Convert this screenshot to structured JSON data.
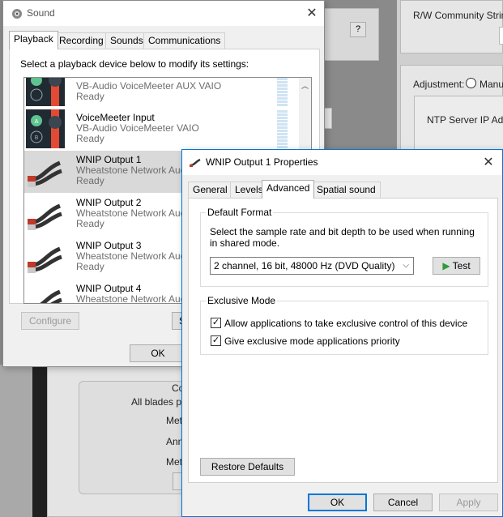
{
  "background": {
    "rw_community_label": "R/W Community String:",
    "adjustment_label": "Adjustment:",
    "manual_partial": "Manua",
    "ntp_label": "NTP Server IP Addr",
    "help_button": "?",
    "panel_heading_partial": "Co",
    "blades_text_partial": "All blades pre",
    "met1": "Met",
    "ann": "Ann",
    "met2": "Met"
  },
  "sound_window": {
    "title": "Sound",
    "tabs": [
      "Playback",
      "Recording",
      "Sounds",
      "Communications"
    ],
    "instruction": "Select a playback device below to modify its settings:",
    "devices": [
      {
        "name": "",
        "desc": "VB-Audio VoiceMeeter AUX VAIO",
        "status": "Ready"
      },
      {
        "name": "VoiceMeeter Input",
        "desc": "VB-Audio VoiceMeeter VAIO",
        "status": "Ready"
      },
      {
        "name": "WNIP Output  1",
        "desc": "Wheatstone Network Aud",
        "status": "Ready"
      },
      {
        "name": "WNIP Output  2",
        "desc": "Wheatstone Network Aud",
        "status": "Ready"
      },
      {
        "name": "WNIP Output  3",
        "desc": "Wheatstone Network Aud",
        "status": "Ready"
      },
      {
        "name": "WNIP Output  4",
        "desc": "Wheatstone Network Aud",
        "status": ""
      }
    ],
    "configure_label": "Configure",
    "set_default_partial": "S",
    "ok_label": "OK"
  },
  "props_dialog": {
    "title": "WNIP Output  1 Properties",
    "tabs": [
      "General",
      "Levels",
      "Advanced",
      "Spatial sound"
    ],
    "default_format": {
      "heading": "Default Format",
      "description": "Select the sample rate and bit depth to be used when running in shared mode.",
      "selected": "2 channel, 16 bit, 48000 Hz (DVD Quality)",
      "test_label": "Test"
    },
    "exclusive_mode": {
      "heading": "Exclusive Mode",
      "allow_label": "Allow applications to take exclusive control of this device",
      "allow_checked": true,
      "priority_label": "Give exclusive mode applications priority",
      "priority_checked": true
    },
    "restore_label": "Restore Defaults",
    "ok_label": "OK",
    "cancel_label": "Cancel",
    "apply_label": "Apply"
  },
  "colors": {
    "accent": "#0078d7",
    "selected_row": "#d9d9d9",
    "cable_red": "#e34a33",
    "voicemeeter_green": "#5fc38f"
  }
}
